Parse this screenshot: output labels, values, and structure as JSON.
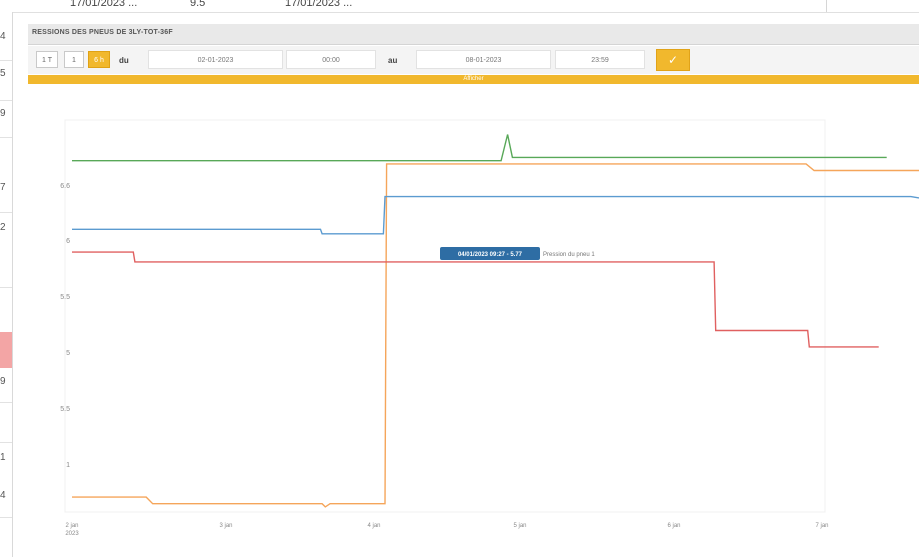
{
  "top_strip": {
    "col1": "17/01/2023 ...",
    "col2": "9.5",
    "col3": "17/01/2023 ..."
  },
  "left_column": {
    "row_values": [
      "4",
      "5",
      "9",
      "7",
      "2",
      "9",
      "1",
      "4"
    ]
  },
  "panel": {
    "title": "RESSIONS DES PNEUS DE 3LY-TOT-36F"
  },
  "toolbar": {
    "buttons": [
      {
        "label": "1 T"
      },
      {
        "label": "1"
      },
      {
        "label": "6 h",
        "active": true
      }
    ],
    "from_label": "du",
    "from_date": "02-01-2023",
    "from_time": "00:00",
    "to_label": "au",
    "to_date": "08-01-2023",
    "to_time": "23:59",
    "ok_icon": "check-icon",
    "banner_text": "Afficher"
  },
  "colors": {
    "accent": "#f1b82d",
    "green": "#58a858",
    "orange": "#f5a55a",
    "blue": "#5b9bd0",
    "red": "#e06060",
    "tooltip_bg": "#2e6da4"
  },
  "chart_data": {
    "type": "line",
    "y_tick_labels": [
      "6.6",
      "6",
      "5.5",
      "5",
      "5.5",
      "1"
    ],
    "x_tick_labels": [
      "2 jan\n2023",
      "3 jan",
      "4 jan",
      "5 jan",
      "6 jan",
      "7 jan"
    ],
    "x_range": [
      0,
      5.25
    ],
    "y_range": [
      0,
      6
    ],
    "tooltip": {
      "value_text": "04/01/2023 09:27 - 5.77",
      "series_text": "Pression du pneu 1"
    },
    "series": [
      {
        "color": "green",
        "points": [
          [
            0,
            5.5
          ],
          [
            2.65,
            5.5
          ],
          [
            2.66,
            5.5
          ],
          [
            2.7,
            5.9
          ],
          [
            2.73,
            5.55
          ],
          [
            2.8,
            5.55
          ],
          [
            5.05,
            5.55
          ]
        ]
      },
      {
        "color": "orange",
        "points": [
          [
            0,
            0.35
          ],
          [
            0.46,
            0.35
          ],
          [
            0.5,
            0.25
          ],
          [
            1.55,
            0.25
          ],
          [
            1.57,
            0.2
          ],
          [
            1.6,
            0.25
          ],
          [
            1.94,
            0.25
          ],
          [
            1.95,
            5.45
          ],
          [
            4.55,
            5.45
          ],
          [
            4.6,
            5.35
          ],
          [
            5.25,
            5.35
          ]
        ]
      },
      {
        "color": "blue",
        "points": [
          [
            0,
            4.45
          ],
          [
            1.54,
            4.45
          ],
          [
            1.55,
            4.38
          ],
          [
            1.93,
            4.38
          ],
          [
            1.94,
            4.95
          ],
          [
            5.2,
            4.95
          ],
          [
            5.25,
            4.93
          ]
        ]
      },
      {
        "color": "red",
        "points": [
          [
            0,
            4.1
          ],
          [
            0.38,
            4.1
          ],
          [
            0.39,
            3.95
          ],
          [
            3.98,
            3.95
          ],
          [
            3.99,
            2.9
          ],
          [
            4.56,
            2.9
          ],
          [
            4.57,
            2.65
          ],
          [
            5.0,
            2.65
          ]
        ]
      }
    ]
  }
}
